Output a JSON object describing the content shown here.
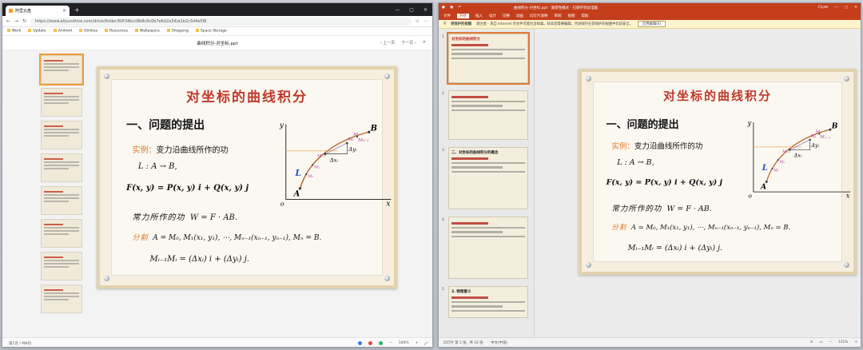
{
  "browser": {
    "tab_title": "阿里云盘",
    "url": "https://www.aliyundrive.com/drive/folder/60f34bcc8b8c9c0b7e6d2a34/a1b2c3d4e5f6",
    "bookmarks": [
      "Work",
      "Update",
      "Android",
      "Utilities",
      "Resources",
      "Wallpapers",
      "Shopping",
      "Space Storage"
    ],
    "doc_title": "曲线积分-对坐标.ppt",
    "nav_prev": "‹ 上一页",
    "nav_next": "下一页 ›",
    "page_indicator": "第1页 / 共8页",
    "zoom": "100%",
    "thumb_count": 8
  },
  "ppt": {
    "title": "曲线积分-对坐标.ppt  -  兼容性模式 - 已保存到此电脑",
    "app_user": "Clyde",
    "menus": [
      "文件",
      "开始",
      "插入",
      "设计",
      "切换",
      "动画",
      "幻灯片放映",
      "审阅",
      "视图",
      "帮助"
    ],
    "active_menu": "开始",
    "warning_label": "受保护的视图",
    "warning_text": "请注意 - 来自 Internet 的文件可能包含病毒。除非您需要编辑，否则保持在受保护的视图中比较安全。",
    "warning_button": "启用编辑(E)",
    "status_left": "幻灯片 第 1 张，共 16 张",
    "status_lang": "中文(中国)",
    "zoom": "121%",
    "thumbs": [
      "1",
      "2",
      "3",
      "4",
      "5"
    ],
    "thumb_headings": [
      "对坐标的曲线积分",
      "",
      "二、对坐标的曲线积分的概念",
      "",
      "3. 物理意义"
    ]
  },
  "slide": {
    "title": "对坐标的曲线积分",
    "heading": "一、问题的提出",
    "example_label": "实例：",
    "example_text": "变力沿曲线所作的功",
    "curve": "L : A → B,",
    "force": "F(x, y) = P(x, y) i + Q(x, y) j",
    "work_label": "常力所作的功",
    "work_eq": "W = F · AB.",
    "partition_label": "分割",
    "partition_eq": "A = M₀, M₁(x₁, y₁), ⋯, Mₙ₋₁(xₙ₋₁, yₙ₋₁), Mₙ = B.",
    "vector_eq": "Mᵢ₋₁Mᵢ = (Δxᵢ) i + (Δyᵢ) j."
  },
  "graph": {
    "axis_x": "x",
    "axis_y": "y",
    "origin": "o",
    "point_a": "A",
    "point_b": "B",
    "curve_label": "L",
    "m_i": "Mᵢ",
    "m_im1": "Mᵢ₋₁",
    "m_n1": "Mₙ₋₁",
    "m_pre": "M",
    "m1": "M₁",
    "m2": "M₂",
    "dx": "Δxᵢ",
    "dy": "Δyᵢ"
  },
  "colors": {
    "title_red": "#c0392b",
    "orange": "#e0792a",
    "ppt_red": "#c43e1c",
    "curve": "#b5652a"
  }
}
